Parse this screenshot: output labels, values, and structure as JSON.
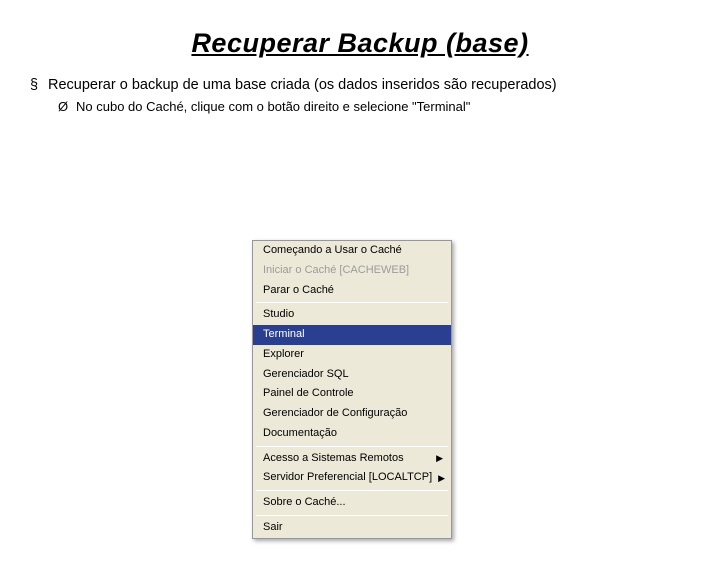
{
  "title": "Recuperar Backup (base)",
  "bullet_symbol": "§",
  "main_bullet": "Recuperar o backup de uma base criada (os dados inseridos  são recuperados)",
  "sub_symbol": "Ø",
  "sub_bullet": "No cubo do Caché, clique com o botão direito e selecione \"Terminal\"",
  "menu": {
    "g1": [
      {
        "label": "Começando a Usar o Caché",
        "disabled": false
      },
      {
        "label": "Iniciar o Caché [CACHEWEB]",
        "disabled": true
      },
      {
        "label": "Parar o Caché",
        "disabled": false
      }
    ],
    "g2": [
      {
        "label": "Studio"
      },
      {
        "label": "Terminal",
        "highlight": true
      },
      {
        "label": "Explorer"
      },
      {
        "label": "Gerenciador SQL"
      },
      {
        "label": "Painel de Controle"
      },
      {
        "label": "Gerenciador de Configuração"
      },
      {
        "label": "Documentação"
      }
    ],
    "g3": [
      {
        "label": "Acesso a Sistemas Remotos",
        "arrow": true
      },
      {
        "label": "Servidor Preferencial [LOCALTCP]",
        "arrow": true
      }
    ],
    "g4": [
      {
        "label": "Sobre o Caché..."
      }
    ],
    "g5": [
      {
        "label": "Sair"
      }
    ]
  }
}
